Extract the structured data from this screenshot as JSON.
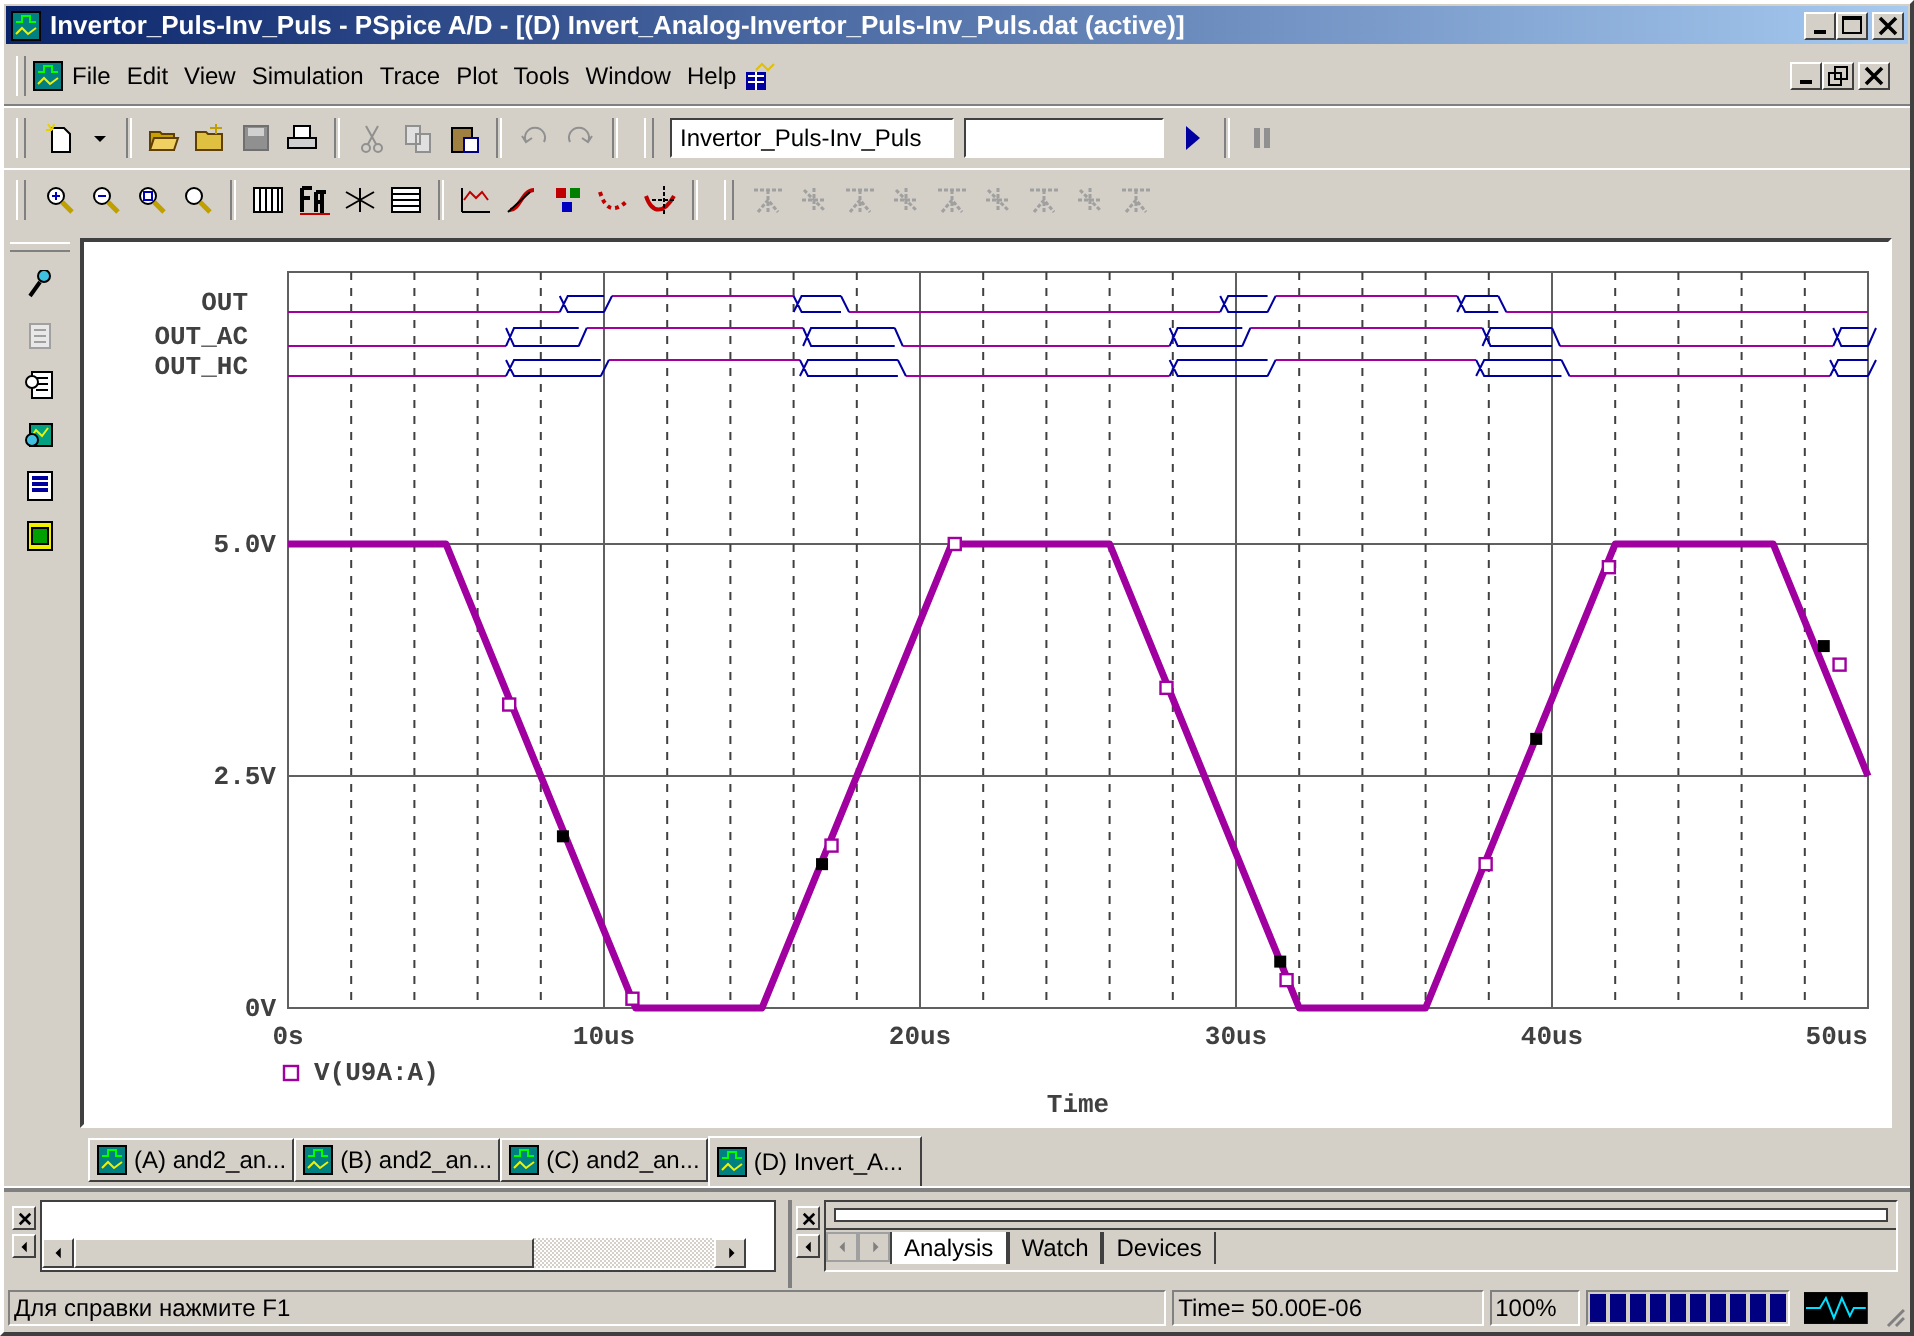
{
  "window": {
    "title": "Invertor_Puls-Inv_Puls - PSpice A/D  - [(D) Invert_Analog-Invertor_Puls-Inv_Puls.dat (active)]"
  },
  "menu": [
    "File",
    "Edit",
    "View",
    "Simulation",
    "Trace",
    "Plot",
    "Tools",
    "Window",
    "Help"
  ],
  "toolbar": {
    "profile": "Invertor_Puls-Inv_Puls"
  },
  "digital_plot": {
    "signals": [
      "OUT",
      "OUT_AC",
      "OUT_HC"
    ]
  },
  "analog_plot": {
    "chart_data": {
      "type": "line",
      "xlabel": "Time",
      "grid": true,
      "x": [
        0,
        5,
        11,
        15,
        21,
        26,
        32,
        36,
        42,
        47,
        50
      ],
      "series": [
        {
          "name": "V(U9A:A)",
          "color": "#a000a0",
          "values": [
            5,
            5,
            0,
            0,
            5,
            5,
            0,
            0,
            5,
            5,
            2.5
          ]
        }
      ],
      "xlim": [
        0,
        50
      ],
      "ylim": [
        0,
        5
      ],
      "xticks": [
        {
          "value": 0,
          "label": "0s"
        },
        {
          "value": 10,
          "label": "10us"
        },
        {
          "value": 20,
          "label": "20us"
        },
        {
          "value": 30,
          "label": "30us"
        },
        {
          "value": 40,
          "label": "40us"
        },
        {
          "value": 50,
          "label": "50us"
        }
      ],
      "yticks": [
        {
          "value": 0,
          "label": "0V"
        },
        {
          "value": 2.5,
          "label": "2.5V"
        },
        {
          "value": 5,
          "label": "5.0V"
        }
      ]
    }
  },
  "tabs": [
    {
      "label": "(A) and2_an...",
      "selected": false
    },
    {
      "label": "(B) and2_an...",
      "selected": false
    },
    {
      "label": "(C) and2_an...",
      "selected": false
    },
    {
      "label": "(D) Invert_A...",
      "selected": true
    }
  ],
  "output_tabs": [
    {
      "label": "Analysis",
      "selected": true
    },
    {
      "label": "Watch",
      "selected": false
    },
    {
      "label": "Devices",
      "selected": false
    }
  ],
  "status_bar": {
    "help": "Для справки нажмите F1",
    "time": "Time= 50.00E-06",
    "percent": "100%",
    "progress": {
      "level": 1
    }
  }
}
